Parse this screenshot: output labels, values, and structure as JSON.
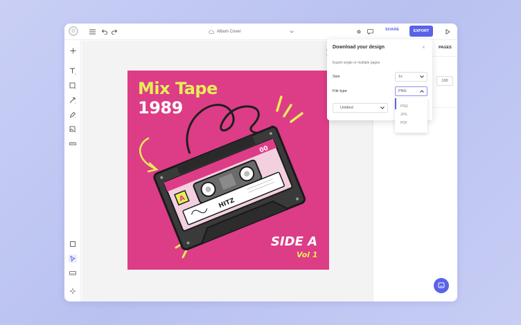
{
  "toolbar": {
    "doc_title": "Album Cover",
    "share_label": "SHARE",
    "export_label": "EXPORT"
  },
  "right_panel": {
    "pages_tab": "PAGES",
    "zoom_value": "100"
  },
  "artboard": {
    "title_line1": "Mix Tape",
    "title_line2": "1989",
    "side_label": "SIDE A",
    "vol_label": "Vol 1",
    "tape_side_letter": "A",
    "tape_number": "00",
    "tape_tag": "HITZ"
  },
  "download_modal": {
    "title": "Download your design",
    "subtitle": "Export single or multiple pages",
    "size_label": "Size",
    "size_value": "1x",
    "filetype_label": "File type",
    "filetype_value": "PNG",
    "pages_value": "Untitled",
    "filetype_options": [
      "PNG",
      "JPG",
      "PDF"
    ]
  },
  "colors": {
    "accent": "#5a63e8",
    "artboard_bg": "#dd3c87",
    "title_yellow": "#e7ee57"
  },
  "icons": {
    "logo": "g-logo-icon",
    "menu": "hamburger-icon",
    "undo": "undo-icon",
    "redo": "redo-icon",
    "cloud": "cloud-icon",
    "chevron": "chevron-down-icon",
    "settings": "gear-icon",
    "comment": "comment-icon",
    "play": "play-icon",
    "chat": "chat-icon"
  }
}
